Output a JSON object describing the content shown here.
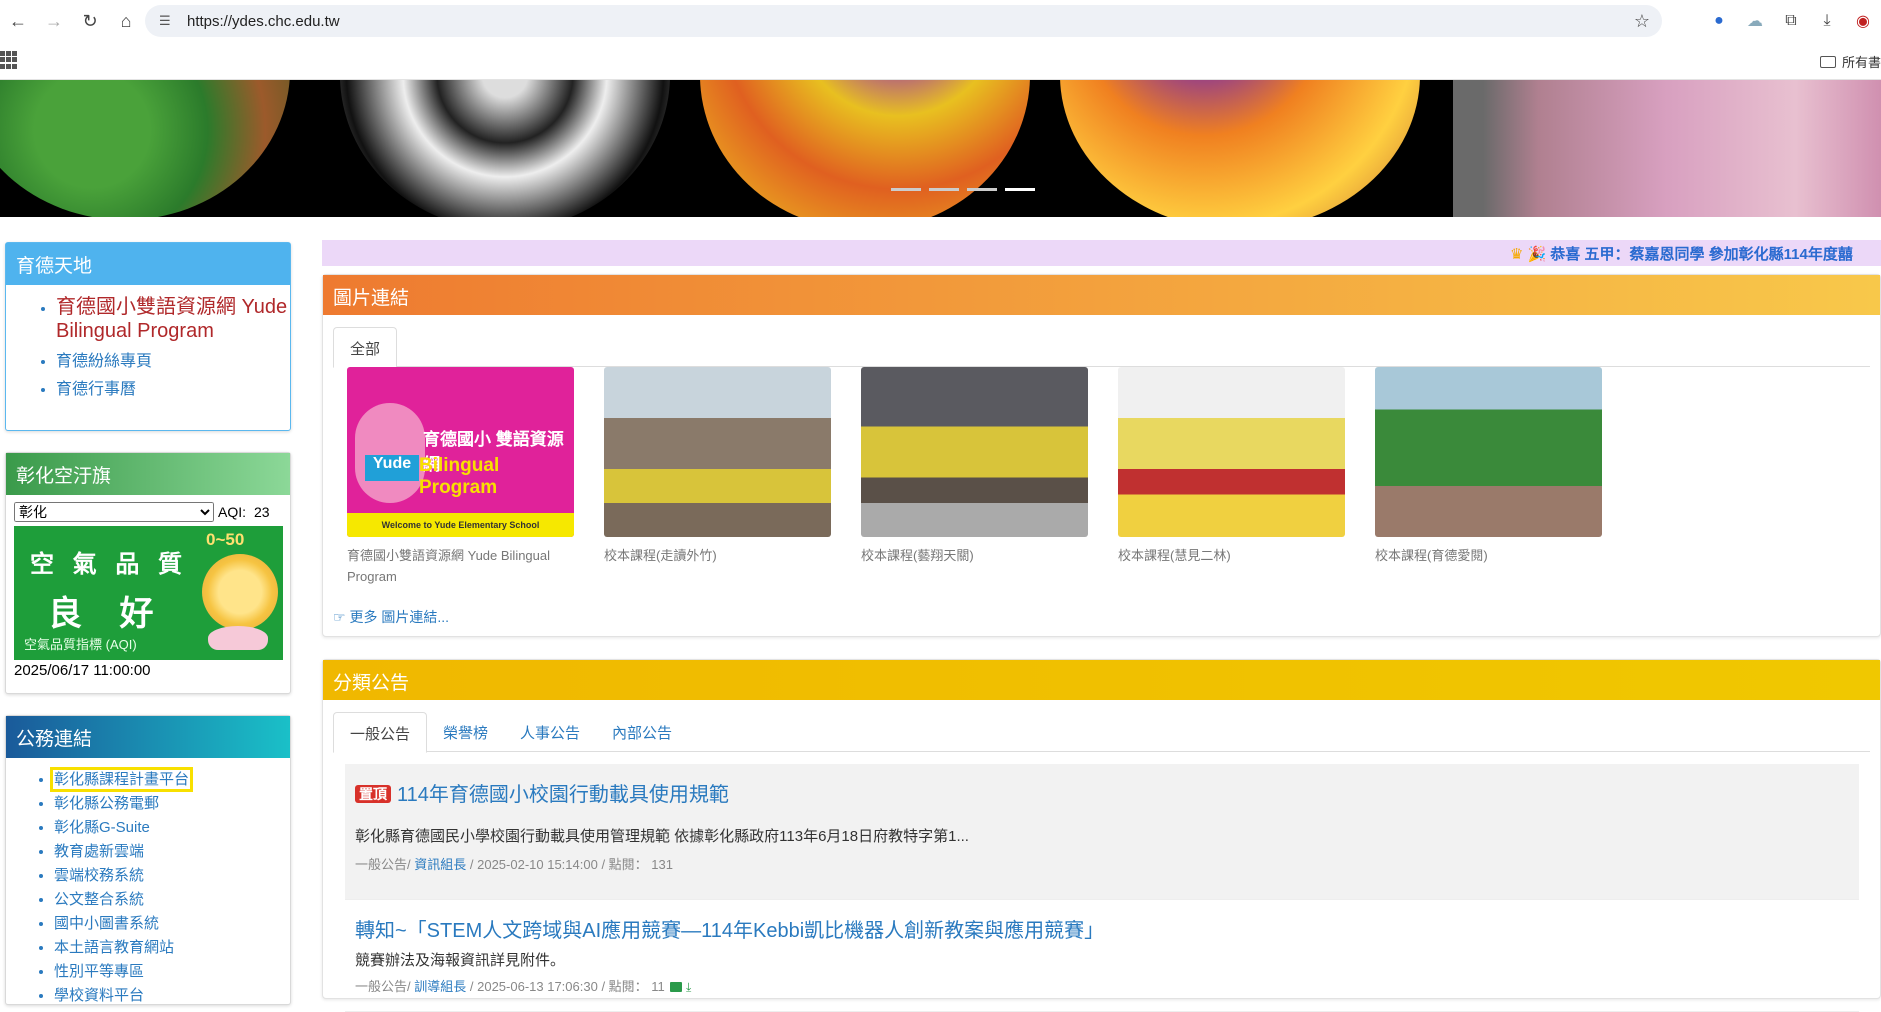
{
  "browser": {
    "url": "https://ydes.chc.edu.tw",
    "back_icon": "←",
    "forward_icon": "→",
    "reload_icon": "↻",
    "home_icon": "⌂",
    "bookmarks_label": "所有書"
  },
  "marquee": {
    "text": "🎉 恭喜 五甲：蔡嘉恩同學 參加彰化縣114年度囍"
  },
  "sidebar": {
    "yude": {
      "title": "育德天地",
      "items": [
        {
          "label": "育德國小雙語資源網 Yude Bilingual Program"
        },
        {
          "label": "育德紛絲專頁"
        },
        {
          "label": "育德行事曆"
        }
      ]
    },
    "air": {
      "title": "彰化空汙旗",
      "select_value": "彰化",
      "aqi_label": "AQI:",
      "aqi_value": "23",
      "image_title": "空 氣 品 質",
      "image_status": "良 好",
      "image_index": "空氣品質指標 (AQI)",
      "image_range": "0~50",
      "datetime": "2025/06/17 11:00:00"
    },
    "links": {
      "title": "公務連結",
      "items": [
        {
          "label": "彰化縣課程計畫平台"
        },
        {
          "label": "彰化縣公務電郵"
        },
        {
          "label": "彰化縣G-Suite"
        },
        {
          "label": "教育處新雲端"
        },
        {
          "label": "雲端校務系統"
        },
        {
          "label": "公文整合系統"
        },
        {
          "label": "國中小圖書系統"
        },
        {
          "label": "本土語言教育網站"
        },
        {
          "label": "性別平等專區"
        },
        {
          "label": "學校資料平台"
        }
      ]
    }
  },
  "image_links": {
    "title": "圖片連結",
    "tab": "全部",
    "items": [
      {
        "caption": "育德國小雙語資源網 Yude Bilingual Program",
        "img_title1": "育德國小 雙語資源網",
        "img_title2": "Bilingual Program",
        "img_logo": "Yude",
        "img_bottom": "Welcome to Yude Elementary School"
      },
      {
        "caption": "校本課程(走讀外竹)"
      },
      {
        "caption": "校本課程(藝翔天關)"
      },
      {
        "caption": "校本課程(慧見二林)"
      },
      {
        "caption": "校本課程(育德愛閱)"
      }
    ],
    "more": "更多 圖片連結..."
  },
  "announcements": {
    "title": "分類公告",
    "tabs": [
      "一般公告",
      "榮譽榜",
      "人事公告",
      "內部公告"
    ],
    "items": [
      {
        "badge": "置頂",
        "title": "114年育德國小校園行動載具使用規範",
        "desc": "彰化縣育德國民小學校園行動載具使用管理規範 依據彰化縣政府113年6月18日府教特字第1...",
        "category": "一般公告/",
        "author": "資訊組長",
        "meta": "/ 2025-02-10 15:14:00 / 點閱： 131"
      },
      {
        "title": "轉知~「STEM人文跨域與AI應用競賽—114年Kebbi凱比機器人創新教案與應用競賽」",
        "desc": "競賽辦法及海報資訊詳見附件。",
        "category": "一般公告/",
        "author": "訓導組長",
        "meta": "/ 2025-06-13 17:06:30 / 點閱： 11"
      }
    ]
  }
}
